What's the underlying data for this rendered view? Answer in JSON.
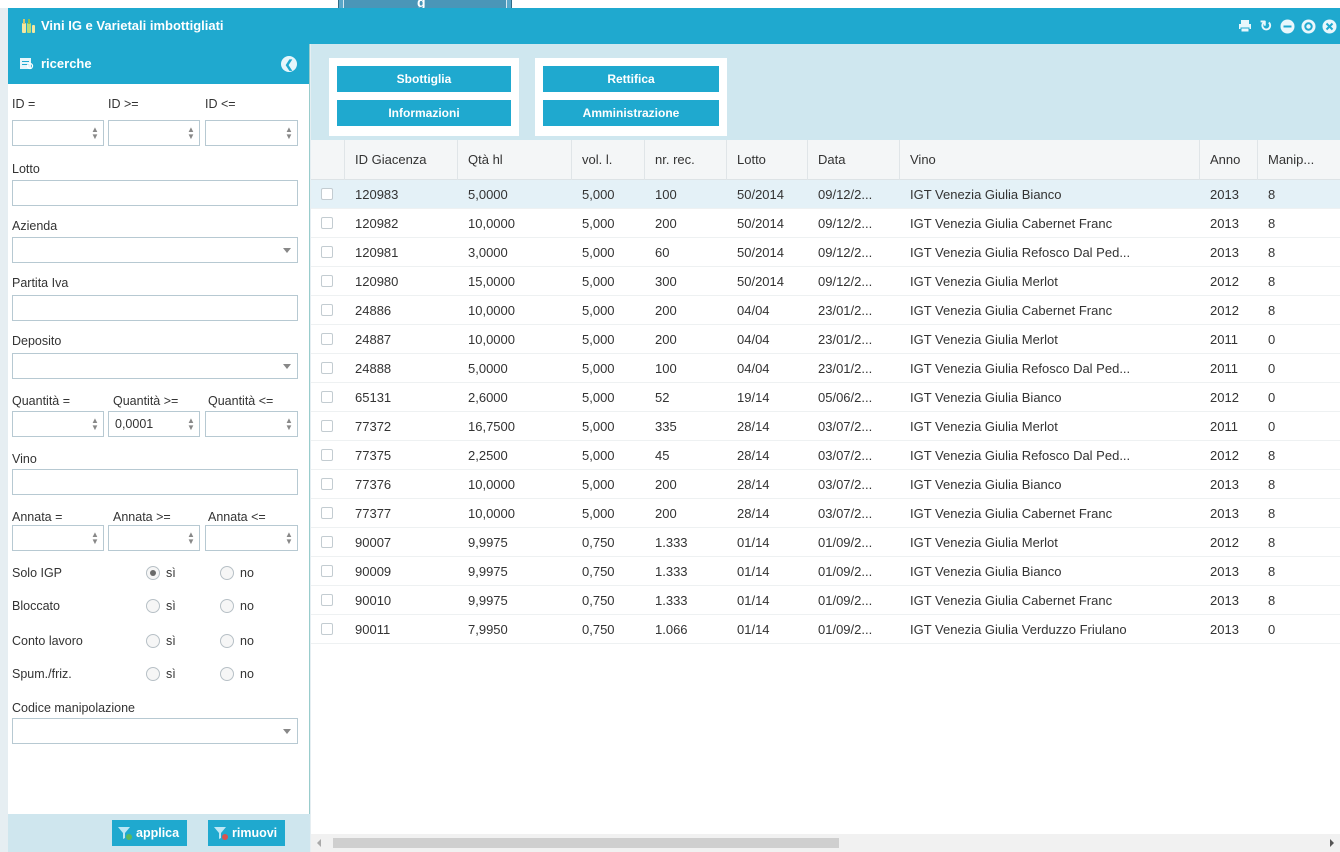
{
  "app": {
    "top_tab_text": "g",
    "title": "Vini IG e Varietali imbottigliati",
    "window_controls": [
      "print-icon",
      "refresh-icon",
      "minimize-icon",
      "restore-icon",
      "close-icon"
    ],
    "accent_color": "#1fa9cf"
  },
  "sidebar": {
    "title": "ricerche",
    "id_eq": "ID =",
    "id_ge": "ID >=",
    "id_le": "ID <=",
    "lotto": "Lotto",
    "azienda": "Azienda",
    "partita_iva": "Partita Iva",
    "deposito": "Deposito",
    "qta_eq": "Quantità =",
    "qta_ge": "Quantità >=",
    "qta_le": "Quantità <=",
    "qta_ge_value": "0,0001",
    "vino": "Vino",
    "annata_eq": "Annata =",
    "annata_ge": "Annata >=",
    "annata_le": "Annata <=",
    "radios": [
      {
        "label": "Solo IGP",
        "si": "sì",
        "no": "no",
        "selected": "si"
      },
      {
        "label": "Bloccato",
        "si": "sì",
        "no": "no",
        "selected": ""
      },
      {
        "label": "Conto lavoro",
        "si": "sì",
        "no": "no",
        "selected": ""
      },
      {
        "label": "Spum./friz.",
        "si": "sì",
        "no": "no",
        "selected": ""
      }
    ],
    "codice": "Codice manipolazione",
    "apply": "applica",
    "remove": "rimuovi"
  },
  "toolbar": {
    "sbottiglia": "Sbottiglia",
    "informazioni": "Informazioni",
    "rettifica": "Rettifica",
    "amministrazione": "Amministrazione"
  },
  "grid": {
    "columns": [
      "ID Giacenza",
      "Qtà hl",
      "vol. l.",
      "nr. rec.",
      "Lotto",
      "Data",
      "Vino",
      "Anno",
      "Manip..."
    ],
    "rows": [
      [
        "120983",
        "5,0000",
        "5,000",
        "100",
        "50/2014",
        "09/12/2...",
        "IGT Venezia Giulia Bianco",
        "2013",
        "8"
      ],
      [
        "120982",
        "10,0000",
        "5,000",
        "200",
        "50/2014",
        "09/12/2...",
        "IGT Venezia Giulia Cabernet Franc",
        "2013",
        "8"
      ],
      [
        "120981",
        "3,0000",
        "5,000",
        "60",
        "50/2014",
        "09/12/2...",
        "IGT Venezia Giulia Refosco Dal Ped...",
        "2013",
        "8"
      ],
      [
        "120980",
        "15,0000",
        "5,000",
        "300",
        "50/2014",
        "09/12/2...",
        "IGT Venezia Giulia Merlot",
        "2012",
        "8"
      ],
      [
        "24886",
        "10,0000",
        "5,000",
        "200",
        "04/04",
        "23/01/2...",
        "IGT Venezia Giulia Cabernet Franc",
        "2012",
        "8"
      ],
      [
        "24887",
        "10,0000",
        "5,000",
        "200",
        "04/04",
        "23/01/2...",
        "IGT Venezia Giulia Merlot",
        "2011",
        "0"
      ],
      [
        "24888",
        "5,0000",
        "5,000",
        "100",
        "04/04",
        "23/01/2...",
        "IGT Venezia Giulia Refosco Dal Ped...",
        "2011",
        "0"
      ],
      [
        "65131",
        "2,6000",
        "5,000",
        "52",
        "19/14",
        "05/06/2...",
        "IGT Venezia Giulia Bianco",
        "2012",
        "0"
      ],
      [
        "77372",
        "16,7500",
        "5,000",
        "335",
        "28/14",
        "03/07/2...",
        "IGT Venezia Giulia Merlot",
        "2011",
        "0"
      ],
      [
        "77375",
        "2,2500",
        "5,000",
        "45",
        "28/14",
        "03/07/2...",
        "IGT Venezia Giulia Refosco Dal Ped...",
        "2012",
        "8"
      ],
      [
        "77376",
        "10,0000",
        "5,000",
        "200",
        "28/14",
        "03/07/2...",
        "IGT Venezia Giulia Bianco",
        "2013",
        "8"
      ],
      [
        "77377",
        "10,0000",
        "5,000",
        "200",
        "28/14",
        "03/07/2...",
        "IGT Venezia Giulia Cabernet Franc",
        "2013",
        "8"
      ],
      [
        "90007",
        "9,9975",
        "0,750",
        "1.333",
        "01/14",
        "01/09/2...",
        "IGT Venezia Giulia Merlot",
        "2012",
        "8"
      ],
      [
        "90009",
        "9,9975",
        "0,750",
        "1.333",
        "01/14",
        "01/09/2...",
        "IGT Venezia Giulia Bianco",
        "2013",
        "8"
      ],
      [
        "90010",
        "9,9975",
        "0,750",
        "1.333",
        "01/14",
        "01/09/2...",
        "IGT Venezia Giulia Cabernet Franc",
        "2013",
        "8"
      ],
      [
        "90011",
        "7,9950",
        "0,750",
        "1.066",
        "01/14",
        "01/09/2...",
        "IGT Venezia Giulia Verduzzo Friulano",
        "2013",
        "0"
      ]
    ]
  }
}
